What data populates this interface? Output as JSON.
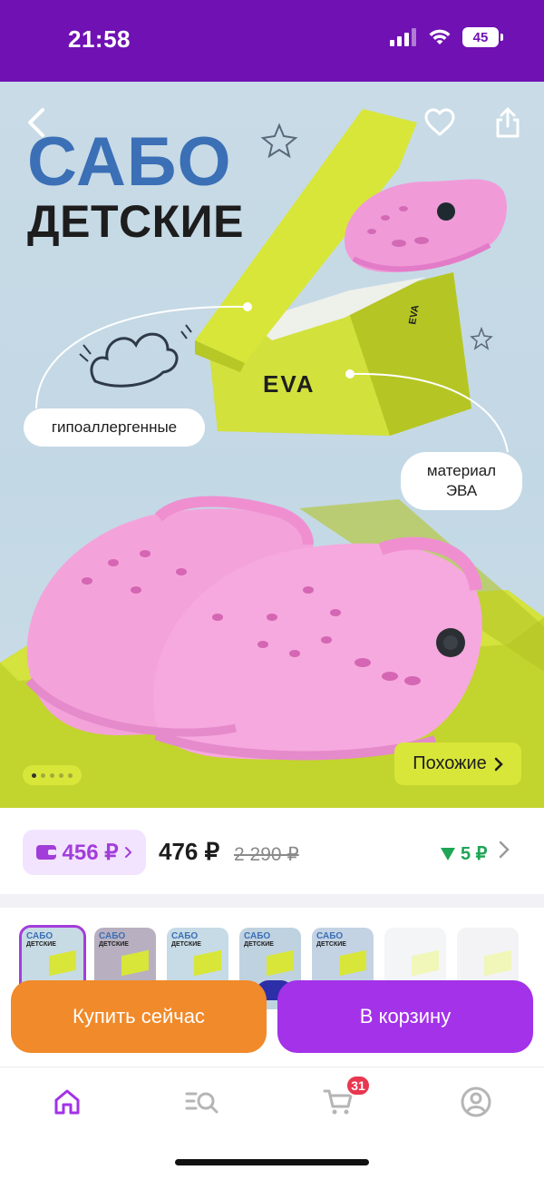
{
  "status_bar": {
    "time": "21:58",
    "battery": "45"
  },
  "hero": {
    "title_line1": "САБО",
    "title_line2": "ДЕТСКИЕ",
    "box_brand": "EVA",
    "tag_hypoallergenic": "гипоаллергенные",
    "tag_material": "материал ЭВА",
    "similar_button": "Похожие",
    "pager": {
      "count": 5,
      "active": 1
    }
  },
  "price": {
    "wallet_price": "456 ₽",
    "current_price": "476 ₽",
    "old_price": "2 290 ₽",
    "cashback": "5 ₽"
  },
  "thumbnails": [
    {
      "title": "САБО",
      "subtitle": "ДЕТСКИЕ",
      "bg": "#c7dbe5",
      "shoe": "#f2a6dc",
      "selected": true
    },
    {
      "title": "САБО",
      "subtitle": "ДЕТСКИЕ",
      "bg": "#b8b0c0",
      "shoe": "#9fd64a",
      "selected": false
    },
    {
      "title": "САБО",
      "subtitle": "ДЕТСКИЕ",
      "bg": "#c6dbe6",
      "shoe": "#3a8fe0",
      "selected": false
    },
    {
      "title": "САБО",
      "subtitle": "ДЕТСКИЕ",
      "bg": "#bfd2e0",
      "shoe": "#2d2fa8",
      "selected": false
    },
    {
      "title": "САБО",
      "subtitle": "ДЕТСКИЕ",
      "bg": "#c3d3e4",
      "shoe": "#f2d33a",
      "selected": false
    },
    {
      "title": "",
      "subtitle": "",
      "bg": "#dfe3ea",
      "shoe": "#a8e0b5",
      "selected": false
    },
    {
      "title": "",
      "subtitle": "",
      "bg": "#dedfe6",
      "shoe": "#5a6b8a",
      "selected": false
    }
  ],
  "actions": {
    "buy_now": "Купить сейчас",
    "add_to_cart": "В корзину"
  },
  "bottom_nav": {
    "cart_badge": "31"
  },
  "colors": {
    "brand_purple": "#6f11b3",
    "accent_purple": "#a332e8",
    "orange": "#f08a2a",
    "lime": "#d8e63a"
  },
  "icons": [
    "back-icon",
    "heart-icon",
    "share-icon",
    "wallet-icon",
    "home-icon",
    "catalog-search-icon",
    "cart-icon",
    "profile-icon"
  ]
}
